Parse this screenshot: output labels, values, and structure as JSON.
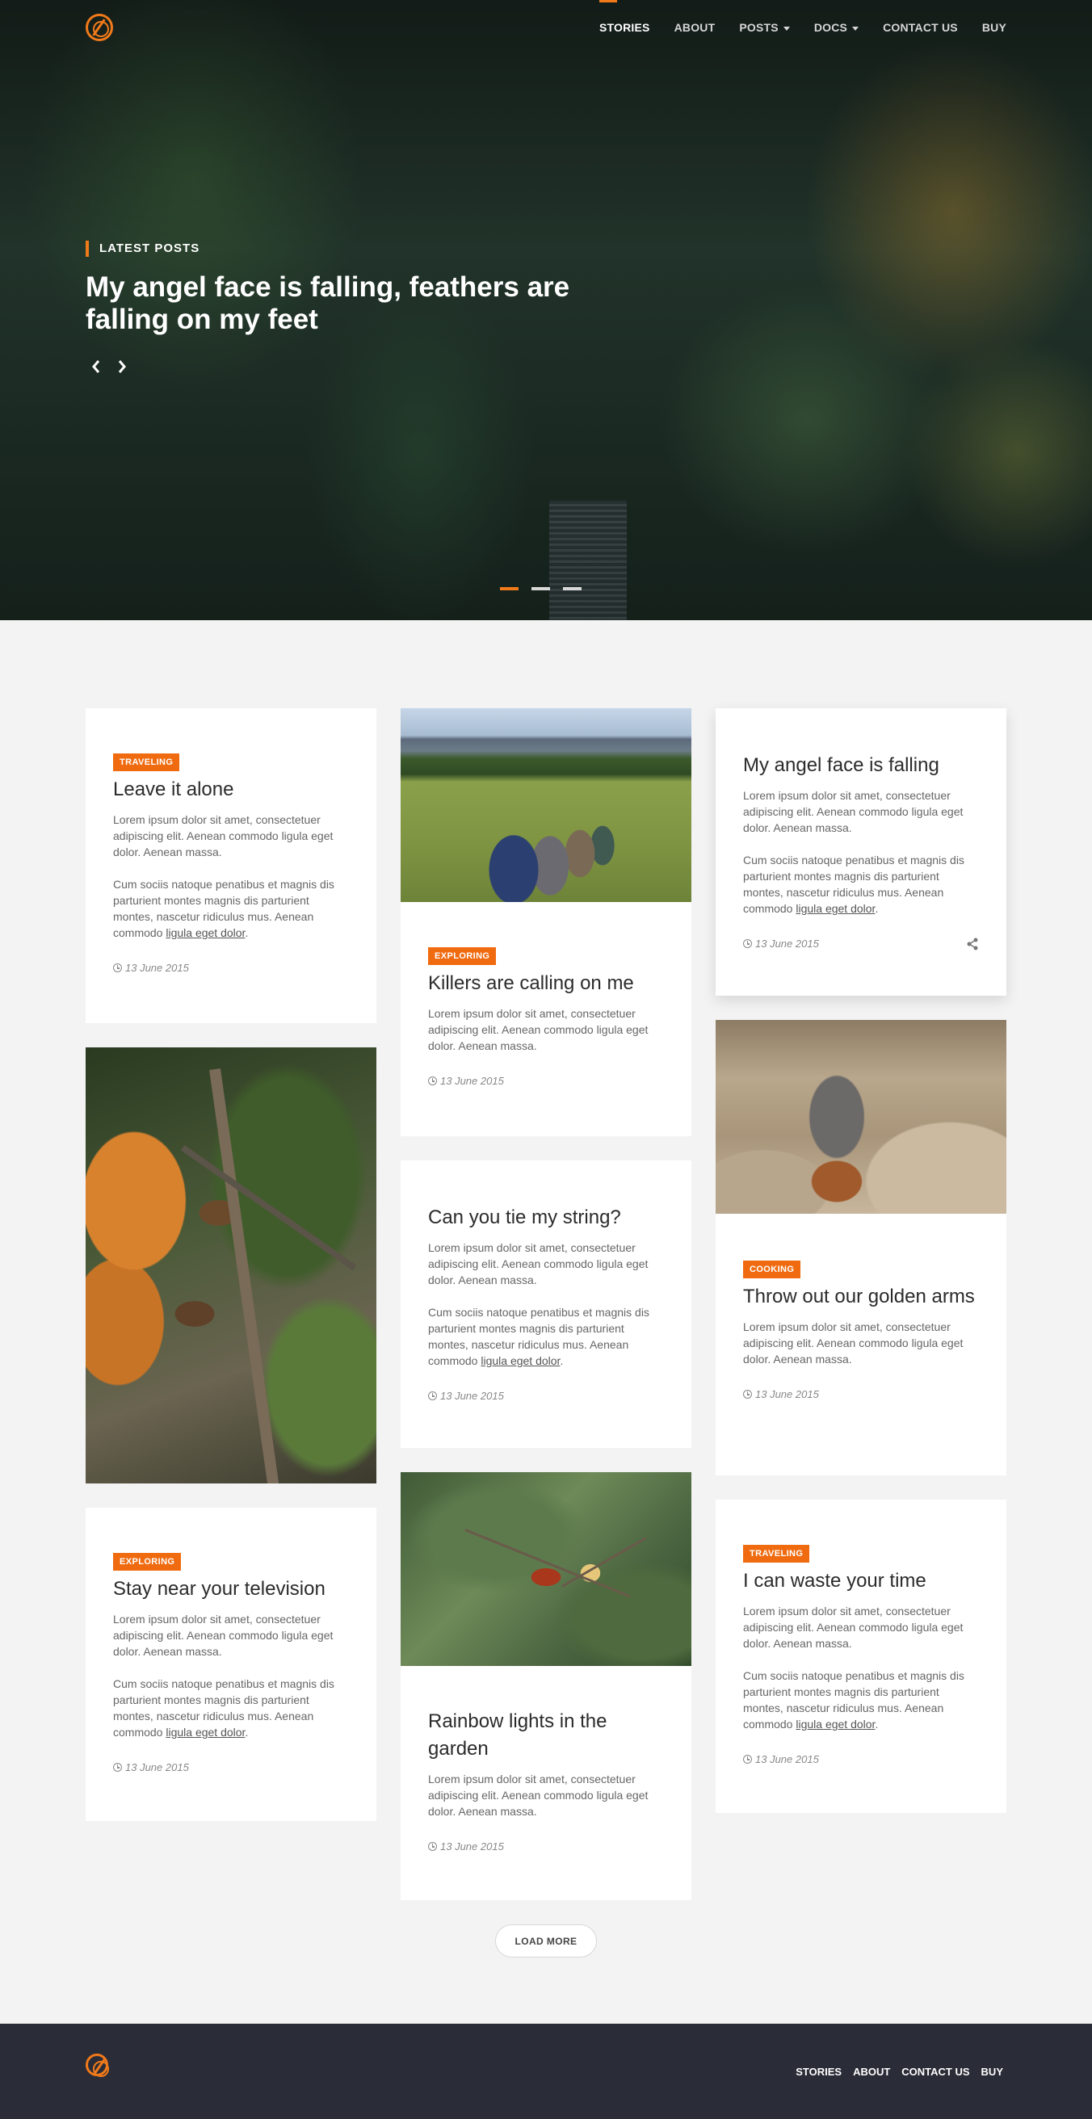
{
  "header": {
    "nav": [
      {
        "label": "STORIES",
        "active": true
      },
      {
        "label": "ABOUT"
      },
      {
        "label": "POSTS",
        "dropdown": true
      },
      {
        "label": "DOCS",
        "dropdown": true
      },
      {
        "label": "CONTACT US"
      },
      {
        "label": "BUY"
      }
    ]
  },
  "hero": {
    "kicker": "LATEST POSTS",
    "title": "My angel face is falling, feathers are falling on my feet",
    "slides_count": 3,
    "active_slide": 1
  },
  "cards": [
    {
      "tag": "TRAVELING",
      "title": "Leave it alone",
      "p1": "Lorem ipsum dolor sit amet, consectetuer adipiscing elit. Aenean commodo ligula eget dolor. Aenean massa.",
      "p2_pre": "Cum sociis natoque penatibus et magnis dis parturient montes magnis dis parturient montes, nascetur ridiculus mus. Aenean commodo ",
      "p2_link": "ligula eget dolor",
      "p2_post": ".",
      "date": "13 June 2015"
    },
    {
      "tag": "EXPLORING",
      "title": "Killers are calling on me",
      "p1": "Lorem ipsum dolor sit amet, consectetuer adipiscing elit. Aenean commodo ligula eget dolor. Aenean massa.",
      "date": "13 June 2015"
    },
    {
      "title": "My angel face is falling",
      "p1": "Lorem ipsum dolor sit amet, consectetuer adipiscing elit. Aenean commodo ligula eget dolor. Aenean massa.",
      "p2_pre": "Cum sociis natoque penatibus et magnis dis parturient montes magnis dis parturient montes, nascetur ridiculus mus. Aenean commodo ",
      "p2_link": "ligula eget dolor",
      "p2_post": ".",
      "date": "13 June 2015"
    },
    {
      "title": "Can you tie my string?",
      "p1": "Lorem ipsum dolor sit amet, consectetuer adipiscing elit. Aenean commodo ligula eget dolor. Aenean massa.",
      "p2_pre": "Cum sociis natoque penatibus et magnis dis parturient montes magnis dis parturient montes, nascetur ridiculus mus. Aenean commodo ",
      "p2_link": "ligula eget dolor",
      "p2_post": ".",
      "date": "13 June 2015"
    },
    {
      "tag": "COOKING",
      "title": "Throw out our golden arms",
      "p1": "Lorem ipsum dolor sit amet, consectetuer adipiscing elit. Aenean commodo ligula eget dolor. Aenean massa.",
      "date": "13 June 2015"
    },
    {
      "tag": "EXPLORING",
      "title": "Stay near your television",
      "p1": "Lorem ipsum dolor sit amet, consectetuer adipiscing elit. Aenean commodo ligula eget dolor. Aenean massa.",
      "p2_pre": "Cum sociis natoque penatibus et magnis dis parturient montes magnis dis parturient montes, nascetur ridiculus mus. Aenean commodo ",
      "p2_link": "ligula eget dolor",
      "p2_post": ".",
      "date": "13 June 2015"
    },
    {
      "tag": "TRAVELING",
      "title": "I can waste your time",
      "p1": "Lorem ipsum dolor sit amet, consectetuer adipiscing elit. Aenean commodo ligula eget dolor. Aenean massa.",
      "p2_pre": "Cum sociis natoque penatibus et magnis dis parturient montes magnis dis parturient montes, nascetur ridiculus mus. Aenean commodo ",
      "p2_link": "ligula eget dolor",
      "p2_post": ".",
      "date": "13 June 2015"
    },
    {
      "title": "Rainbow lights in the garden",
      "p1": "Lorem ipsum dolor sit amet, consectetuer adipiscing elit. Aenean commodo ligula eget dolor. Aenean massa.",
      "date": "13 June 2015"
    }
  ],
  "load_more": "LOAD MORE",
  "footer": {
    "nav": [
      "STORIES",
      "ABOUT",
      "CONTACT US",
      "BUY"
    ]
  },
  "colors": {
    "accent": "#f07a1a",
    "tag": "#f06b10",
    "background": "#f3f3f3",
    "footer": "#2a2c37"
  },
  "icons": [
    "logo-icon",
    "chevron-left-icon",
    "chevron-right-icon",
    "clock-icon",
    "share-icon",
    "caret-down-icon"
  ]
}
